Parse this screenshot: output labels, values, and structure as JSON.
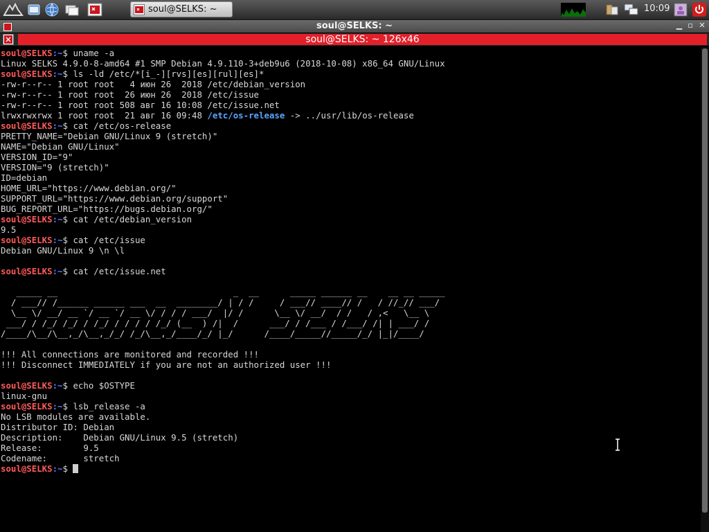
{
  "panel": {
    "task_title": "soul@SELKS: ~",
    "clock": "10:09"
  },
  "window": {
    "title": "soul@SELKS: ~"
  },
  "terminal": {
    "title": "soul@SELKS: ~ 126x46",
    "prompt_user": "soul@SELKS",
    "prompt_path": ":~",
    "prompt_sym": "$ ",
    "lines": [
      {
        "type": "cmd",
        "text": "uname -a"
      },
      {
        "type": "out",
        "text": "Linux SELKS 4.9.0-8-amd64 #1 SMP Debian 4.9.110-3+deb9u6 (2018-10-08) x86_64 GNU/Linux"
      },
      {
        "type": "cmd",
        "text": "ls -ld /etc/*[i_-][rvs][es][rul][es]*"
      },
      {
        "type": "out",
        "text": "-rw-r--r-- 1 root root   4 июн 26  2018 /etc/debian_version"
      },
      {
        "type": "out",
        "text": "-rw-r--r-- 1 root root  26 июн 26  2018 /etc/issue"
      },
      {
        "type": "out",
        "text": "-rw-r--r-- 1 root root 508 авг 16 10:08 /etc/issue.net"
      },
      {
        "type": "link",
        "pre": "lrwxrwxrwx 1 root root  21 авг 16 09:48 ",
        "hl": "/etc/os-release",
        "post": " -> ../usr/lib/os-release"
      },
      {
        "type": "cmd",
        "text": "cat /etc/os-release"
      },
      {
        "type": "out",
        "text": "PRETTY_NAME=\"Debian GNU/Linux 9 (stretch)\""
      },
      {
        "type": "out",
        "text": "NAME=\"Debian GNU/Linux\""
      },
      {
        "type": "out",
        "text": "VERSION_ID=\"9\""
      },
      {
        "type": "out",
        "text": "VERSION=\"9 (stretch)\""
      },
      {
        "type": "out",
        "text": "ID=debian"
      },
      {
        "type": "out",
        "text": "HOME_URL=\"https://www.debian.org/\""
      },
      {
        "type": "out",
        "text": "SUPPORT_URL=\"https://www.debian.org/support\""
      },
      {
        "type": "out",
        "text": "BUG_REPORT_URL=\"https://bugs.debian.org/\""
      },
      {
        "type": "cmd",
        "text": "cat /etc/debian_version"
      },
      {
        "type": "out",
        "text": "9.5"
      },
      {
        "type": "cmd",
        "text": "cat /etc/issue"
      },
      {
        "type": "out",
        "text": "Debian GNU/Linux 9 \\n \\l"
      },
      {
        "type": "out",
        "text": ""
      },
      {
        "type": "cmd",
        "text": "cat /etc/issue.net"
      },
      {
        "type": "out",
        "text": ""
      },
      {
        "type": "out",
        "text": "   _____ __                                  _  __      _____ ______ __    __ __ _____"
      },
      {
        "type": "out",
        "text": "  / ___// /______ ______ ___  __  ________/ | / /     / ___// ____// /   / //_// ___/"
      },
      {
        "type": "out",
        "text": "  \\__ \\/ __/ __ `/ __ `/ __ \\/ / / / ___/  |/ /      \\__ \\/ __/  / /   / ,<   \\__ \\"
      },
      {
        "type": "out",
        "text": " ___/ / /_/ /_/ / /_/ / / / / /_/ (__  ) /|  /      ___/ / /___ / /___/ /| | ___/ /"
      },
      {
        "type": "out",
        "text": "/____/\\__/\\__,_/\\__,_/_/ /_/\\__,_/____/_/ |_/      /____/_____//_____/_/ |_|/____/"
      },
      {
        "type": "out",
        "text": ""
      },
      {
        "type": "out",
        "text": "!!! All connections are monitored and recorded !!!"
      },
      {
        "type": "out",
        "text": "!!! Disconnect IMMEDIATELY if you are not an authorized user !!!"
      },
      {
        "type": "out",
        "text": ""
      },
      {
        "type": "cmd",
        "text": "echo $OSTYPE"
      },
      {
        "type": "out",
        "text": "linux-gnu"
      },
      {
        "type": "cmd",
        "text": "lsb_release -a"
      },
      {
        "type": "out",
        "text": "No LSB modules are available."
      },
      {
        "type": "out",
        "text": "Distributor ID: Debian"
      },
      {
        "type": "out",
        "text": "Description:    Debian GNU/Linux 9.5 (stretch)"
      },
      {
        "type": "out",
        "text": "Release:        9.5"
      },
      {
        "type": "out",
        "text": "Codename:       stretch"
      },
      {
        "type": "prompt",
        "text": ""
      }
    ]
  },
  "colors": {
    "prompt_user": "#ff5a5a",
    "prompt_path": "#5b7cff",
    "symlink": "#5aa6ff",
    "title_red": "#e3202a"
  },
  "icons": [
    "app-menu-icon",
    "browser-icon",
    "file-manager-icon",
    "desktop-icon",
    "terminal-icon",
    "cpu-graph-icon",
    "clipboard-icon",
    "network-icon",
    "user-icon",
    "power-icon"
  ]
}
